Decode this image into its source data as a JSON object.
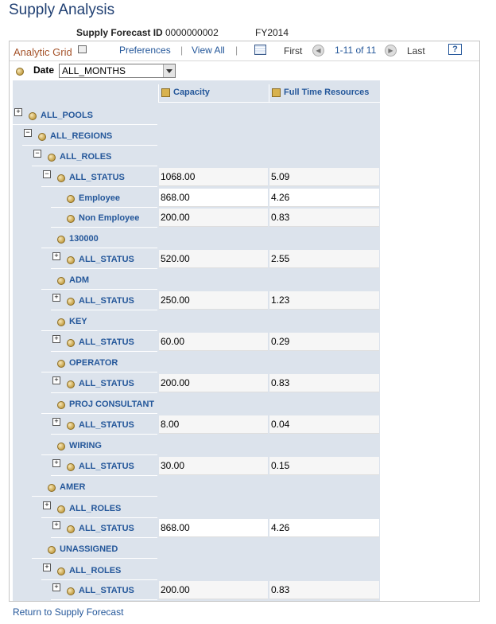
{
  "page_title": "Supply Analysis",
  "header": {
    "forecast_id_label": "Supply Forecast ID",
    "forecast_id_value": "0000000002",
    "fiscal_year": "FY2014"
  },
  "toolbar": {
    "grid_title": "Analytic Grid",
    "preferences": "Preferences",
    "view_all": "View All",
    "first": "First",
    "range": "1-11 of 11",
    "last": "Last",
    "help": "?"
  },
  "filter": {
    "date_label": "Date",
    "date_value": "ALL_MONTHS"
  },
  "columns": [
    "Capacity",
    "Full Time Resources"
  ],
  "tree": [
    {
      "label": "ALL_POOLS",
      "expander": "+",
      "capacity": "",
      "ftr": ""
    },
    {
      "label": "ALL_REGIONS",
      "expander": "−",
      "capacity": "",
      "ftr": ""
    },
    {
      "label": "ALL_ROLES",
      "expander": "−",
      "capacity": "",
      "ftr": ""
    },
    {
      "label": "ALL_STATUS",
      "expander": "−",
      "capacity": "1068.00",
      "ftr": "5.09"
    },
    {
      "label": "Employee",
      "expander": "",
      "capacity": "868.00",
      "ftr": "4.26"
    },
    {
      "label": "Non Employee",
      "expander": "",
      "capacity": "200.00",
      "ftr": "0.83"
    },
    {
      "label": "130000",
      "expander": "",
      "capacity": "",
      "ftr": ""
    },
    {
      "label": "ALL_STATUS",
      "expander": "+",
      "capacity": "520.00",
      "ftr": "2.55"
    },
    {
      "label": "ADM",
      "expander": "",
      "capacity": "",
      "ftr": ""
    },
    {
      "label": "ALL_STATUS",
      "expander": "+",
      "capacity": "250.00",
      "ftr": "1.23"
    },
    {
      "label": "KEY",
      "expander": "",
      "capacity": "",
      "ftr": ""
    },
    {
      "label": "ALL_STATUS",
      "expander": "+",
      "capacity": "60.00",
      "ftr": "0.29"
    },
    {
      "label": "OPERATOR",
      "expander": "",
      "capacity": "",
      "ftr": ""
    },
    {
      "label": "ALL_STATUS",
      "expander": "+",
      "capacity": "200.00",
      "ftr": "0.83"
    },
    {
      "label": "PROJ CONSULTANT",
      "expander": "",
      "capacity": "",
      "ftr": ""
    },
    {
      "label": "ALL_STATUS",
      "expander": "+",
      "capacity": "8.00",
      "ftr": "0.04"
    },
    {
      "label": "WIRING",
      "expander": "",
      "capacity": "",
      "ftr": ""
    },
    {
      "label": "ALL_STATUS",
      "expander": "+",
      "capacity": "30.00",
      "ftr": "0.15"
    },
    {
      "label": "AMER",
      "expander": "",
      "capacity": "",
      "ftr": ""
    },
    {
      "label": "ALL_ROLES",
      "expander": "+",
      "capacity": "",
      "ftr": ""
    },
    {
      "label": "ALL_STATUS",
      "expander": "+",
      "capacity": "868.00",
      "ftr": "4.26"
    },
    {
      "label": "UNASSIGNED",
      "expander": "",
      "capacity": "",
      "ftr": ""
    },
    {
      "label": "ALL_ROLES",
      "expander": "+",
      "capacity": "",
      "ftr": ""
    },
    {
      "label": "ALL_STATUS",
      "expander": "+",
      "capacity": "200.00",
      "ftr": "0.83"
    }
  ],
  "footer": {
    "return_link": "Return to Supply Forecast"
  }
}
